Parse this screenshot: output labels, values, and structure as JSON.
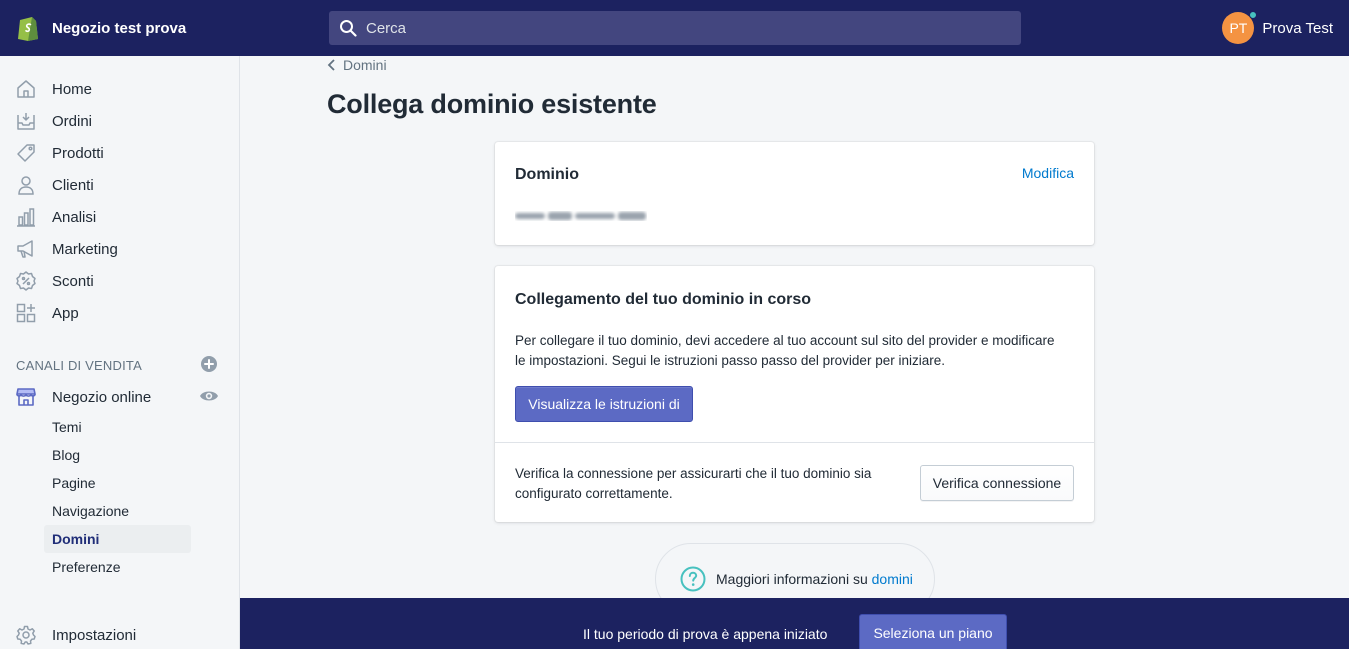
{
  "topbar": {
    "store_name": "Negozio test prova",
    "search_placeholder": "Cerca",
    "avatar_initials": "PT",
    "user_name": "Prova Test"
  },
  "sidebar": {
    "items": [
      {
        "label": "Home",
        "icon": "home-icon"
      },
      {
        "label": "Ordini",
        "icon": "orders-icon"
      },
      {
        "label": "Prodotti",
        "icon": "tag-icon"
      },
      {
        "label": "Clienti",
        "icon": "person-icon"
      },
      {
        "label": "Analisi",
        "icon": "bar-chart-icon"
      },
      {
        "label": "Marketing",
        "icon": "megaphone-icon"
      },
      {
        "label": "Sconti",
        "icon": "discount-icon"
      },
      {
        "label": "App",
        "icon": "apps-icon"
      }
    ],
    "section_title": "CANALI DI VENDITA",
    "channel": {
      "label": "Negozio online",
      "icon": "store-icon"
    },
    "sub_items": [
      "Temi",
      "Blog",
      "Pagine",
      "Navigazione",
      "Domini",
      "Preferenze"
    ],
    "active_sub_item": "Domini",
    "settings": {
      "label": "Impostazioni",
      "icon": "gear-icon"
    }
  },
  "main": {
    "breadcrumb": "Domini",
    "title": "Collega dominio esistente",
    "domain_card": {
      "heading": "Dominio",
      "edit_link": "Modifica"
    },
    "connect_card": {
      "heading": "Collegamento del tuo dominio in corso",
      "text_line1": "Per collegare il tuo dominio, devi accedere al tuo account sul sito del provider e modificare",
      "text_line2": "le impostazioni. Segui le istruzioni passo passo del provider per iniziare.",
      "instructions_button": "Visualizza le istruzioni di",
      "verify_text_line1": "Verifica la connessione per assicurarti che il tuo dominio sia",
      "verify_text_line2": "configurato correttamente.",
      "verify_button": "Verifica connessione"
    },
    "help": {
      "text": "Maggiori informazioni su ",
      "link": "domini"
    }
  },
  "trial_bar": {
    "text": "Il tuo periodo di prova è appena iniziato",
    "button": "Seleziona un piano"
  },
  "colors": {
    "topbar": "#1c2260",
    "primary": "#5c6ac4",
    "link": "#007ace",
    "shopify_green": "#95bf47",
    "avatar": "#f49342"
  }
}
